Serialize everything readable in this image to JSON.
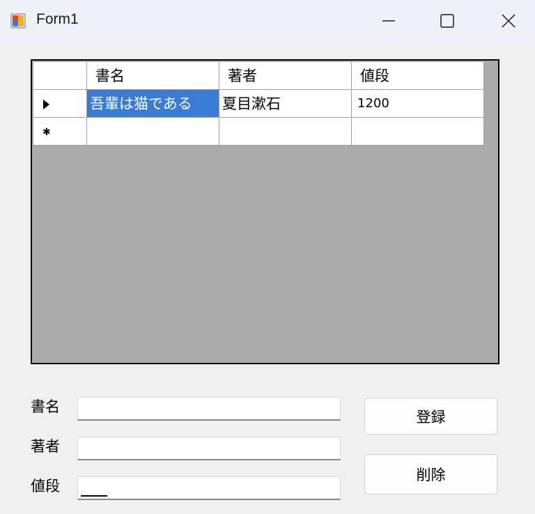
{
  "window": {
    "title": "Form1"
  },
  "grid": {
    "columns": [
      "書名",
      "著者",
      "値段"
    ],
    "rows": [
      [
        "吾輩は猫である",
        "夏目漱石",
        "1200"
      ],
      [
        "",
        "",
        ""
      ]
    ]
  },
  "form": {
    "labels": {
      "title": "書名",
      "author": "著者",
      "price": "値段"
    },
    "values": {
      "title": "",
      "author": "",
      "price": ""
    }
  },
  "buttons": {
    "register": "登録",
    "delete": "削除"
  },
  "icons": {
    "app": "app-icon",
    "minimize": "minimize-icon",
    "maximize": "maximize-icon",
    "close": "close-icon"
  }
}
